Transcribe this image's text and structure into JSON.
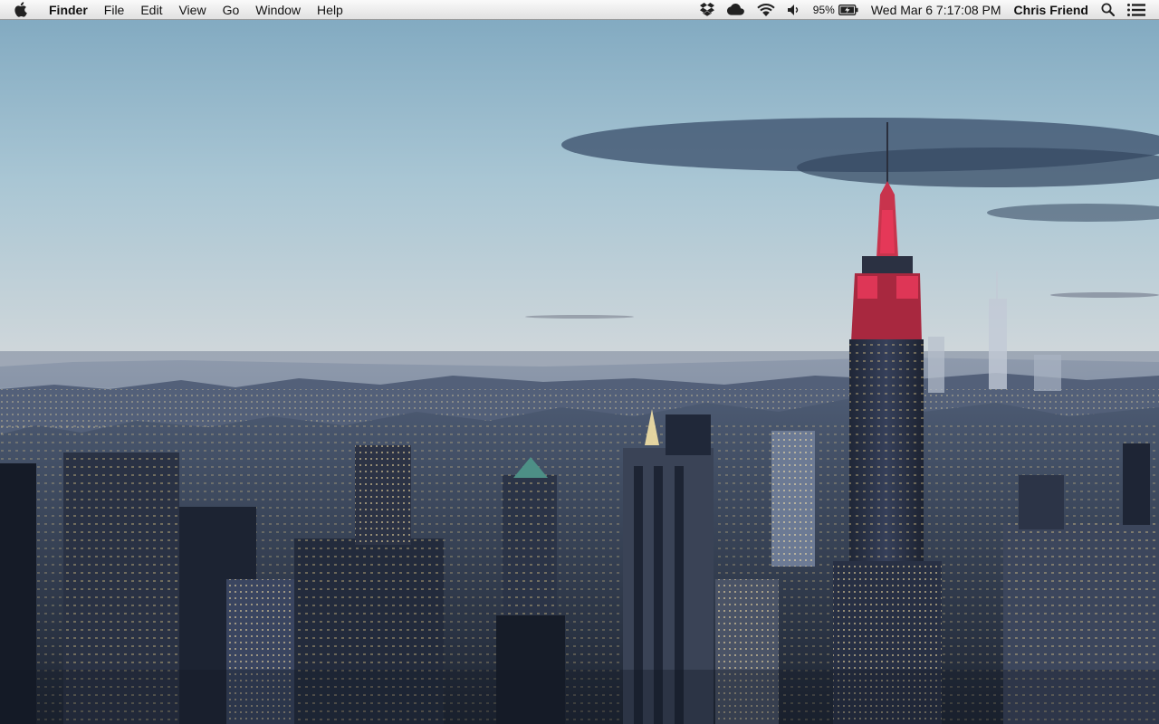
{
  "menubar": {
    "app_name": "Finder",
    "menus": [
      "File",
      "Edit",
      "View",
      "Go",
      "Window",
      "Help"
    ],
    "status": {
      "battery_percent": "95%",
      "datetime": "Wed Mar 6  7:17:08 PM",
      "user_name": "Chris Friend"
    },
    "icons": [
      "apple-icon",
      "dropbox-icon",
      "cloud-icon",
      "wifi-icon",
      "volume-icon",
      "battery-icon",
      "spotlight-search-icon",
      "notification-center-icon"
    ]
  },
  "wallpaper": {
    "description_colors": {
      "sky_top": "#8fb3c8",
      "sky_horizon": "#e9d2cc",
      "spire_glow": "#e8385a",
      "city": "#2e3a4e"
    }
  }
}
